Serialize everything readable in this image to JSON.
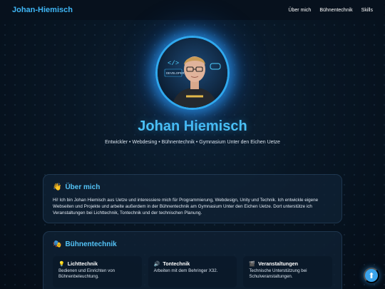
{
  "navbar": {
    "brand": "Johan-Hiemisch",
    "links": [
      "Über mich",
      "Bühnentechnik",
      "Skills"
    ]
  },
  "hero": {
    "avatar_alt": "Profilbild",
    "avatar_sticker_text": "DEVELOPER",
    "title": "Johan Hiemisch",
    "subtitle": "Entwickler • Webdesing • Bühnentechnik • Gymnasium Unter den Eichen Uetze"
  },
  "about": {
    "icon": "👋",
    "title": "Über mich",
    "text": "Hi! Ich bin Johan Hiemisch aus Uetze und interessiere mich für Programmierung, Webdesign, Unity und Technik. Ich entwickle eigene Webseiten und Projekte und arbeite außerdem in der Bühnentechnik am Gymnasium Unter den Eichen Uetze. Dort unterstütze ich Veranstaltungen bei Lichttechnik, Tontechnik und der technischen Planung."
  },
  "stage": {
    "icon": "🎭",
    "title": "Bühnentechnik",
    "items": [
      {
        "icon": "💡",
        "title": "Lichttechnik",
        "text": "Bedienen und Einrichten von Bühnenbeleuchtung."
      },
      {
        "icon": "🔊",
        "title": "Tontechnik",
        "text": "Arbeiten mit dem Behringer X32."
      },
      {
        "icon": "🎬",
        "title": "Veranstaltungen",
        "text": "Technische Unterstützung bei Schulveranstaltungen."
      }
    ]
  },
  "scroll_top": {
    "icon": "⬆"
  },
  "colors": {
    "accent": "#4cc3f7",
    "background": "#081624",
    "card": "#102236"
  }
}
